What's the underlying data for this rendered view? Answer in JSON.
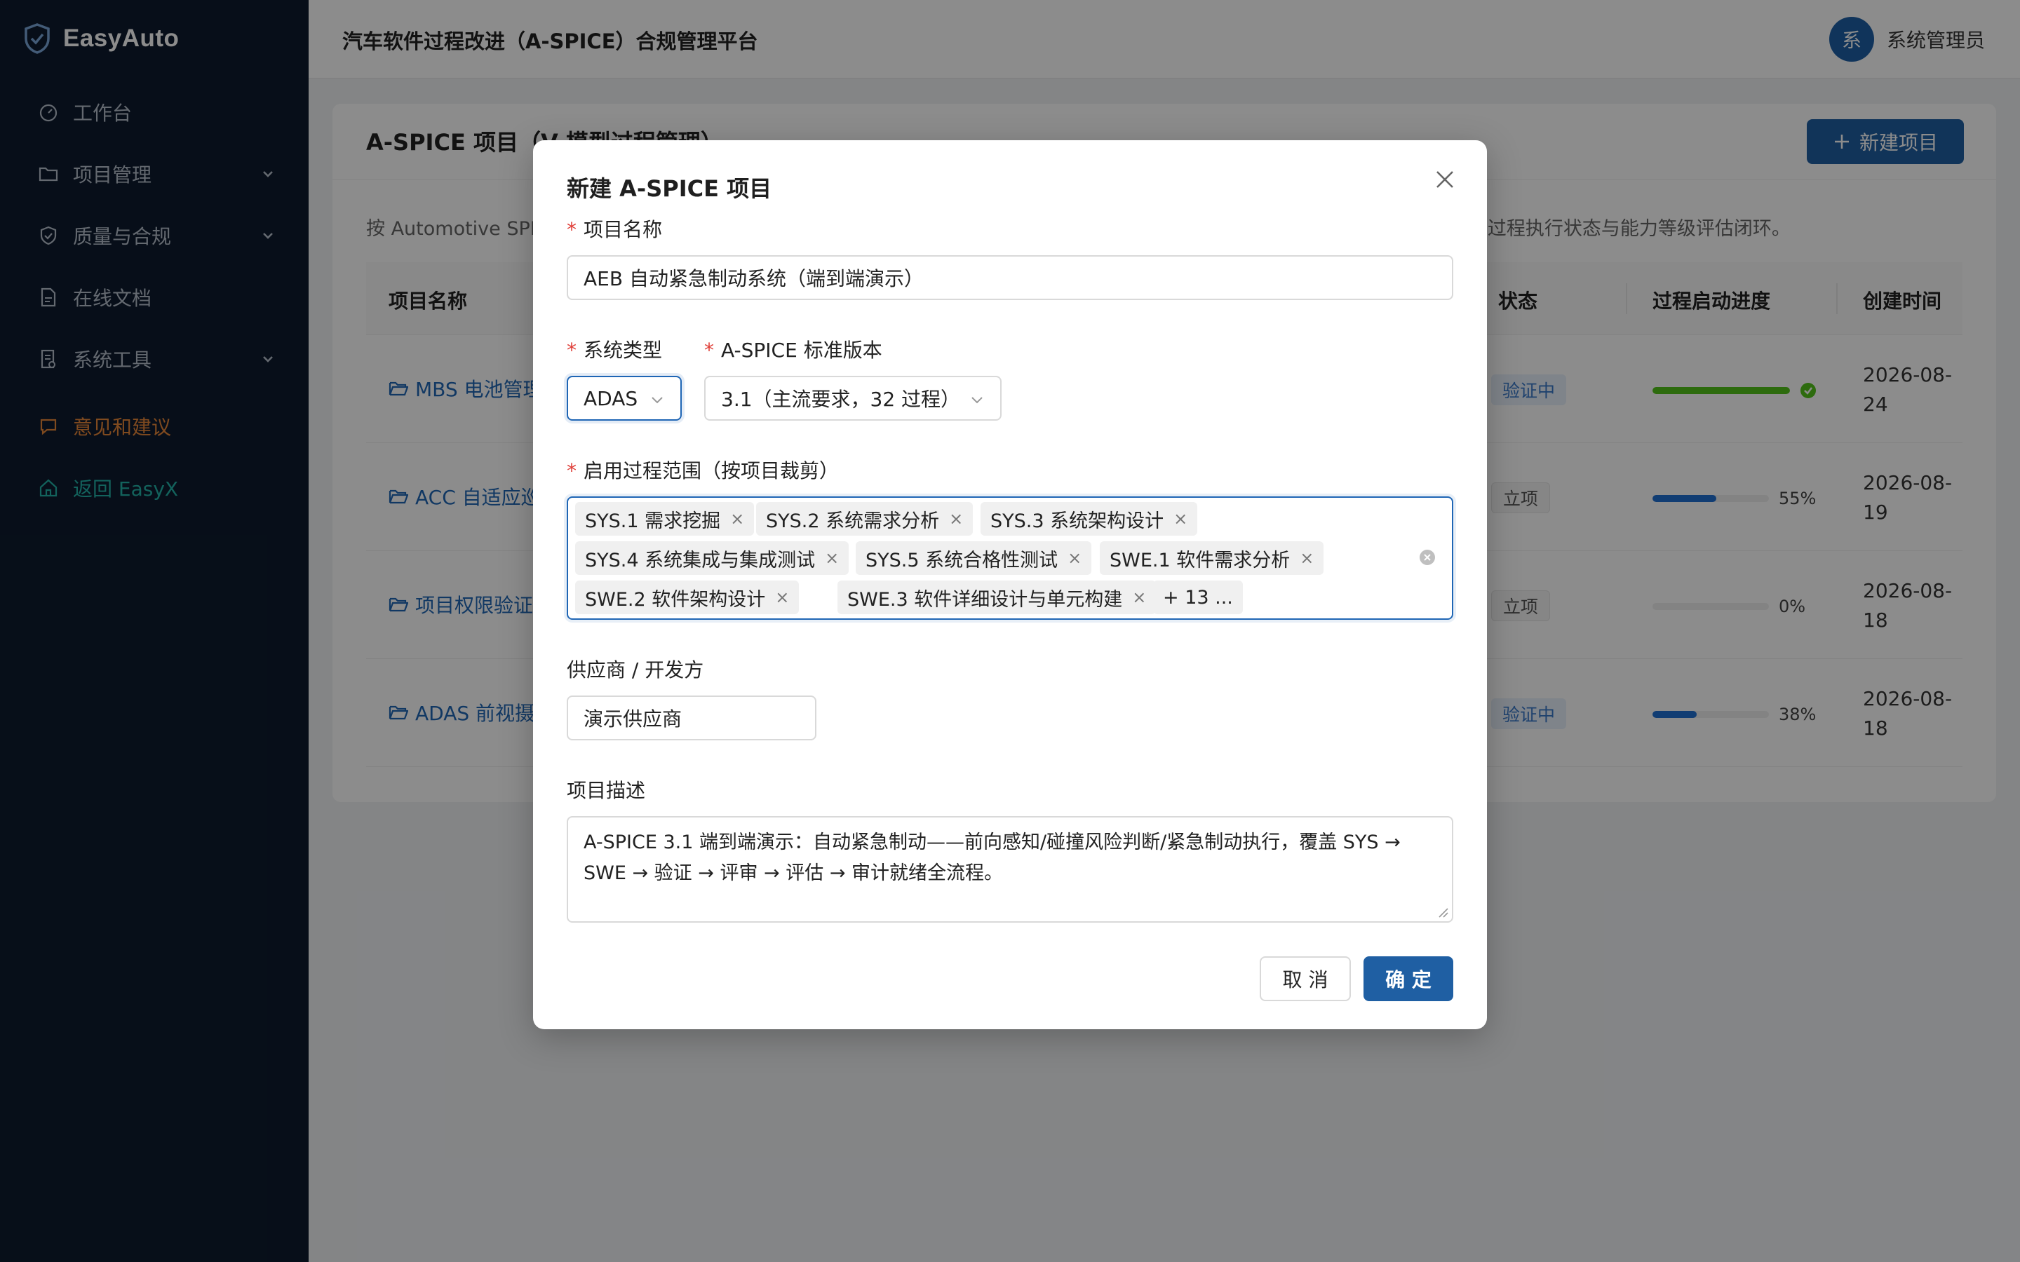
{
  "app": {
    "name": "EasyAuto",
    "header_title": "汽车软件过程改进（A-SPICE）合规管理平台"
  },
  "user": {
    "avatar_char": "系",
    "name": "系统管理员"
  },
  "sidebar": {
    "items": [
      {
        "label": "工作台",
        "icon": "dashboard-icon"
      },
      {
        "label": "项目管理",
        "icon": "folder-icon"
      },
      {
        "label": "质量与合规",
        "icon": "shield-check-icon"
      },
      {
        "label": "在线文档",
        "icon": "document-icon"
      },
      {
        "label": "系统工具",
        "icon": "tools-icon"
      },
      {
        "label": "意见和建议",
        "icon": "feedback-icon"
      },
      {
        "label": "返回 EasyX",
        "icon": "home-icon"
      }
    ]
  },
  "page": {
    "title": "A-SPICE 项目（V 模型过程管理）",
    "new_button": "新建项目",
    "description": "按 Automotive SPICE 管理）， 过程执行状态与能力等级评估闭环。",
    "desc_left": "按 Automotive SPI",
    "desc_right": "管理）， 过程执行状态与能力等级评估闭环。",
    "columns": {
      "name": "项目名称",
      "status": "状态",
      "progress": "过程启动进度",
      "created": "创建时间"
    },
    "rows": [
      {
        "name": "MBS 电池管理",
        "status": "验证中",
        "status_style": "blue",
        "progress": 100,
        "progress_label": "",
        "date": "2026-08-24"
      },
      {
        "name": "ACC 自适应巡",
        "status": "立项",
        "status_style": "gray",
        "progress": 55,
        "progress_label": "55%",
        "date": "2026-08-19"
      },
      {
        "name": "项目权限验证",
        "status": "立项",
        "status_style": "gray",
        "progress": 0,
        "progress_label": "0%",
        "date": "2026-08-18"
      },
      {
        "name": "ADAS 前视摄",
        "status": "验证中",
        "status_style": "blue",
        "progress": 38,
        "progress_label": "38%",
        "date": "2026-08-18"
      }
    ]
  },
  "modal": {
    "title": "新建 A-SPICE 项目",
    "name_label": "项目名称",
    "name_value": "AEB 自动紧急制动系统（端到端演示）",
    "system_type_label": "系统类型",
    "system_type_value": "ADAS",
    "version_label": "A-SPICE 标准版本",
    "version_value": "3.1（主流要求，32 过程）",
    "scope_label": "启用过程范围（按项目裁剪）",
    "tags": [
      "SYS.1 需求挖掘",
      "SYS.2 系统需求分析",
      "SYS.3 系统架构设计",
      "SYS.4 系统集成与集成测试",
      "SYS.5 系统合格性测试",
      "SWE.1 软件需求分析",
      "SWE.2 软件架构设计",
      "SWE.3 软件详细设计与单元构建"
    ],
    "more_tag": "+ 13 ...",
    "supplier_label": "供应商 / 开发方",
    "supplier_value": "演示供应商",
    "desc_label": "项目描述",
    "desc_line1": "A-SPICE 3.1 端到端演示：自动紧急制动——前向感知/碰撞风险判断/紧急制动执行，覆盖 SYS →",
    "desc_line2": "SWE → 验证 → 评审 → 评估 → 审计就绪全流程。",
    "cancel": "取 消",
    "ok": "确 定"
  },
  "colors": {
    "sidebar_bg": "#0d1b2e",
    "primary": "#1f5fa3",
    "link": "#1f66b5",
    "orange": "#e8873a",
    "teal": "#23b3a8",
    "success": "#52c41a"
  }
}
